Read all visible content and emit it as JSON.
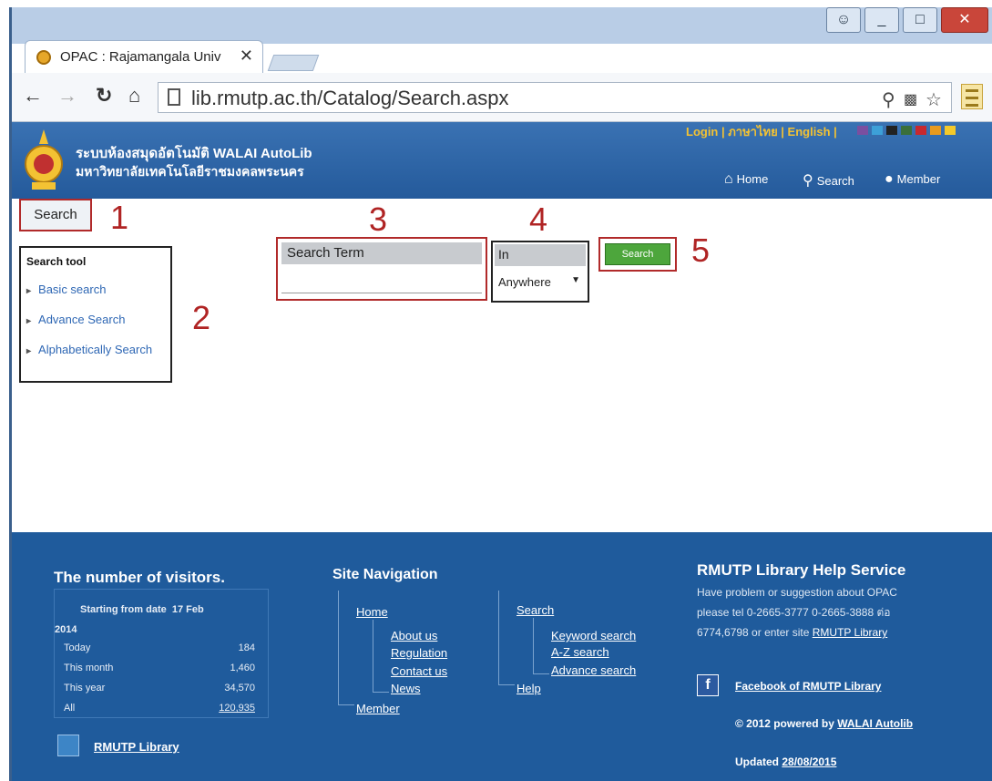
{
  "browser": {
    "tab_title": "OPAC : Rajamangala Univ",
    "tab_close": "✕",
    "url": "lib.rmutp.ac.th/Catalog/Search.aspx",
    "window_buttons": [
      "_",
      "□",
      "✕"
    ]
  },
  "header": {
    "title_th": "ระบบห้องสมุดอัตโนมัติ WALAI AutoLib",
    "subtitle_th": "มหาวิทยาลัยเทคโนโลยีราชมงคลพระนคร",
    "top_links": "Login | ภาษาไทย | English |",
    "swatch_colors": [
      "#7a4fa0",
      "#3da0d8",
      "#222222",
      "#3a6f3a",
      "#c8282e",
      "#e89a1e",
      "#f4c92a"
    ],
    "nav": {
      "home": "Home",
      "search": "Search",
      "member": "Member"
    }
  },
  "search_tab": {
    "label": "Search",
    "marker": "1"
  },
  "search_tool": {
    "title": "Search tool",
    "marker": "2",
    "links": [
      "Basic search",
      "Advance Search",
      "Alphabetically Search"
    ]
  },
  "search_term": {
    "label": "Search Term",
    "value": "",
    "marker": "3"
  },
  "search_in": {
    "label": "In",
    "selected": "Anywhere",
    "marker": "4"
  },
  "search_button": {
    "label": "Search",
    "marker": "5"
  },
  "footer": {
    "visitors": {
      "heading": "The number of visitors.",
      "start_label": "Starting from date",
      "start_date": "17 Feb",
      "start_year": "2014",
      "rows": [
        {
          "label": "Today",
          "value": "184"
        },
        {
          "label": "This month",
          "value": "1,460"
        },
        {
          "label": "This year",
          "value": "34,570"
        },
        {
          "label": "All",
          "value": "120,935"
        }
      ],
      "library_link": "RMUTP Library"
    },
    "site_nav": {
      "heading": "Site Navigation",
      "home": "Home",
      "home_children": [
        "About us",
        "Regulation",
        "Contact us",
        "News"
      ],
      "member": "Member",
      "search": "Search",
      "search_children": [
        "Keyword search",
        "A-Z search",
        "Advance search"
      ],
      "help": "Help"
    },
    "help": {
      "heading": "RMUTP Library Help Service",
      "line1": "Have problem or suggestion about OPAC",
      "line2": "please tel 0-2665-3777 0-2665-3888 ต่อ",
      "line3": "6774,6798 or enter site",
      "link": "RMUTP Library",
      "facebook": "Facebook of RMUTP Library",
      "powered_prefix": "© 2012 powered by",
      "powered_link": "WALAI Autolib",
      "updated_prefix": "Updated",
      "updated_date": "28/08/2015"
    }
  }
}
